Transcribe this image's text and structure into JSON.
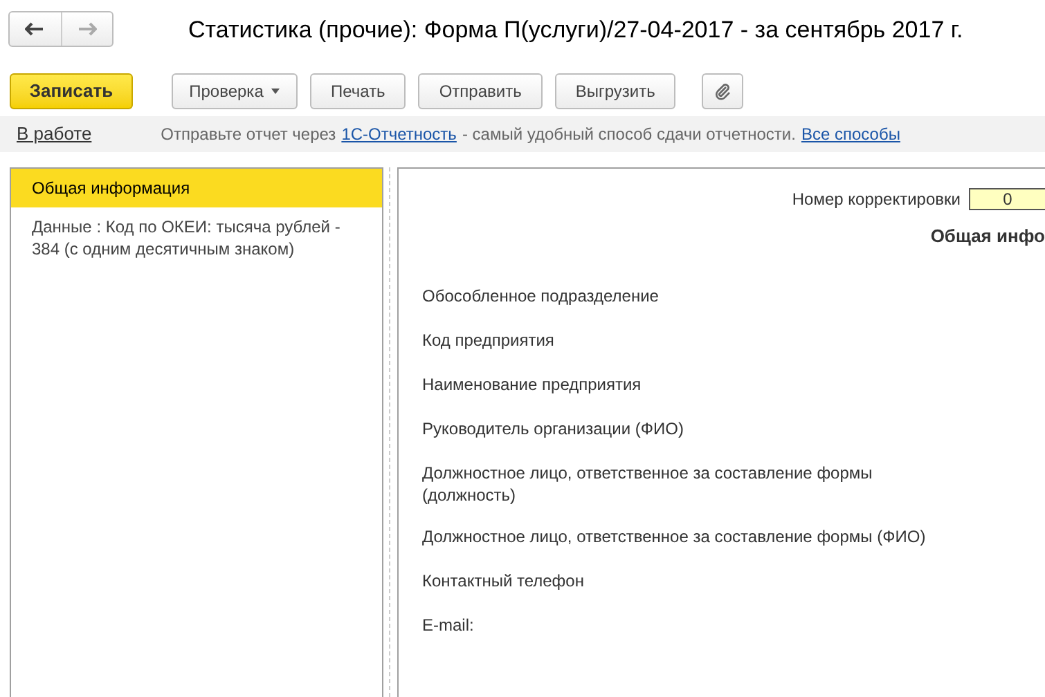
{
  "window": {
    "title": "Статистика (прочие): Форма П(услуги)/27-04-2017 - за сентябрь 2017 г."
  },
  "toolbar": {
    "buttons": [
      {
        "label": "Записать",
        "kind": "primary"
      },
      {
        "label": "Проверка",
        "kind": "dropdown"
      },
      {
        "label": "Печать",
        "kind": "plain"
      },
      {
        "label": "Отправить",
        "kind": "plain"
      },
      {
        "label": "Выгрузить",
        "kind": "plain"
      },
      {
        "kind": "attach"
      }
    ]
  },
  "info_bar": {
    "status": "В работе",
    "text_before": "Отправьте отчет через",
    "link": "1С-Отчетность",
    "text_after": "- самый удобный способ сдачи отчетности.",
    "all_link": "Все способы"
  },
  "sidebar": {
    "items": [
      {
        "label": "Общая информация",
        "selected": true
      },
      {
        "label": "Данные :  Код по ОКЕИ: тысяча рублей - 384 (с одним десятичным знаком)",
        "selected": false
      }
    ]
  },
  "sheet": {
    "correction_label": "Номер корректировки",
    "correction_value": "0",
    "heading": "Общая инфо",
    "fields": [
      {
        "label": "Обособленное подразделение"
      },
      {
        "label": "Код предприятия"
      },
      {
        "label": "Наименование предприятия"
      },
      {
        "label": "Руководитель организации (ФИО)"
      },
      {
        "label": "Должностное лицо, ответственное за составление формы (должность)"
      },
      {
        "label": "Должностное лицо, ответственное за составление формы (ФИО)"
      },
      {
        "label": "Контактный телефон"
      },
      {
        "label": "E-mail:"
      }
    ]
  }
}
